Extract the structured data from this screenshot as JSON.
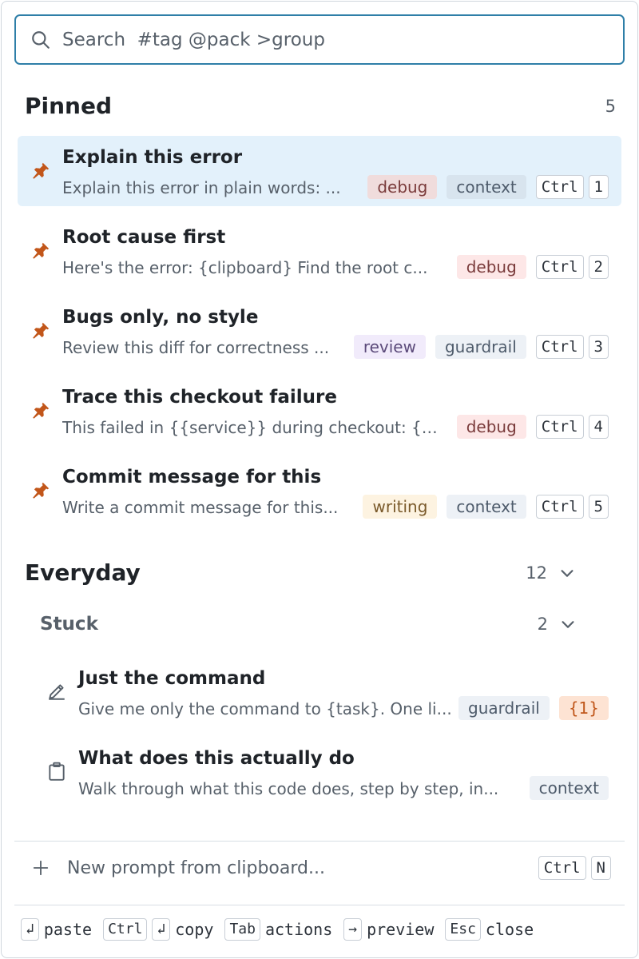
{
  "search": {
    "placeholder": "Search  #tag @pack >group"
  },
  "pinned": {
    "title": "Pinned",
    "count": "5",
    "items": [
      {
        "title": "Explain this error",
        "desc": "Explain this error in plain words: ...",
        "tags": [
          "debug",
          "context"
        ],
        "keys": [
          "Ctrl",
          "1"
        ]
      },
      {
        "title": "Root cause first",
        "desc": "Here's the error: {clipboard} Find the root c...",
        "tags": [
          "debug"
        ],
        "keys": [
          "Ctrl",
          "2"
        ]
      },
      {
        "title": "Bugs only, no style",
        "desc": "Review this diff for correctness ...",
        "tags": [
          "review",
          "guardrail"
        ],
        "keys": [
          "Ctrl",
          "3"
        ]
      },
      {
        "title": "Trace this checkout failure",
        "desc": "This failed in {{service}} during checkout: {cl...",
        "tags": [
          "debug"
        ],
        "keys": [
          "Ctrl",
          "4"
        ]
      },
      {
        "title": "Commit message for this",
        "desc": "Write a commit message for this...",
        "tags": [
          "writing",
          "context"
        ],
        "keys": [
          "Ctrl",
          "5"
        ]
      }
    ]
  },
  "everyday": {
    "title": "Everyday",
    "count": "12",
    "groups": [
      {
        "title": "Stuck",
        "count": "2",
        "items": [
          {
            "title": "Just the command",
            "desc": "Give me only the command to {task}. One li...",
            "tags": [
              "guardrail",
              "{1}"
            ],
            "icon": "pencil-icon"
          },
          {
            "title": "What does this actually do",
            "desc": "Walk through what this code does, step by step, in...",
            "tags": [
              "context"
            ],
            "icon": "clipboard-icon"
          }
        ]
      }
    ]
  },
  "new_prompt": {
    "label": "New prompt from clipboard...",
    "keys": [
      "Ctrl",
      "N"
    ]
  },
  "footer": {
    "k1": "↲",
    "w1": "paste",
    "k2": "Ctrl",
    "k3": "↲",
    "w2": "copy",
    "k4": "Tab",
    "w3": "actions",
    "k5": "→",
    "w4": "preview",
    "k6": "Esc",
    "w5": "close"
  },
  "colors": {
    "accent": "#2f7fa8",
    "pin": "#c2561a",
    "active_row": "#e3f1fb"
  }
}
